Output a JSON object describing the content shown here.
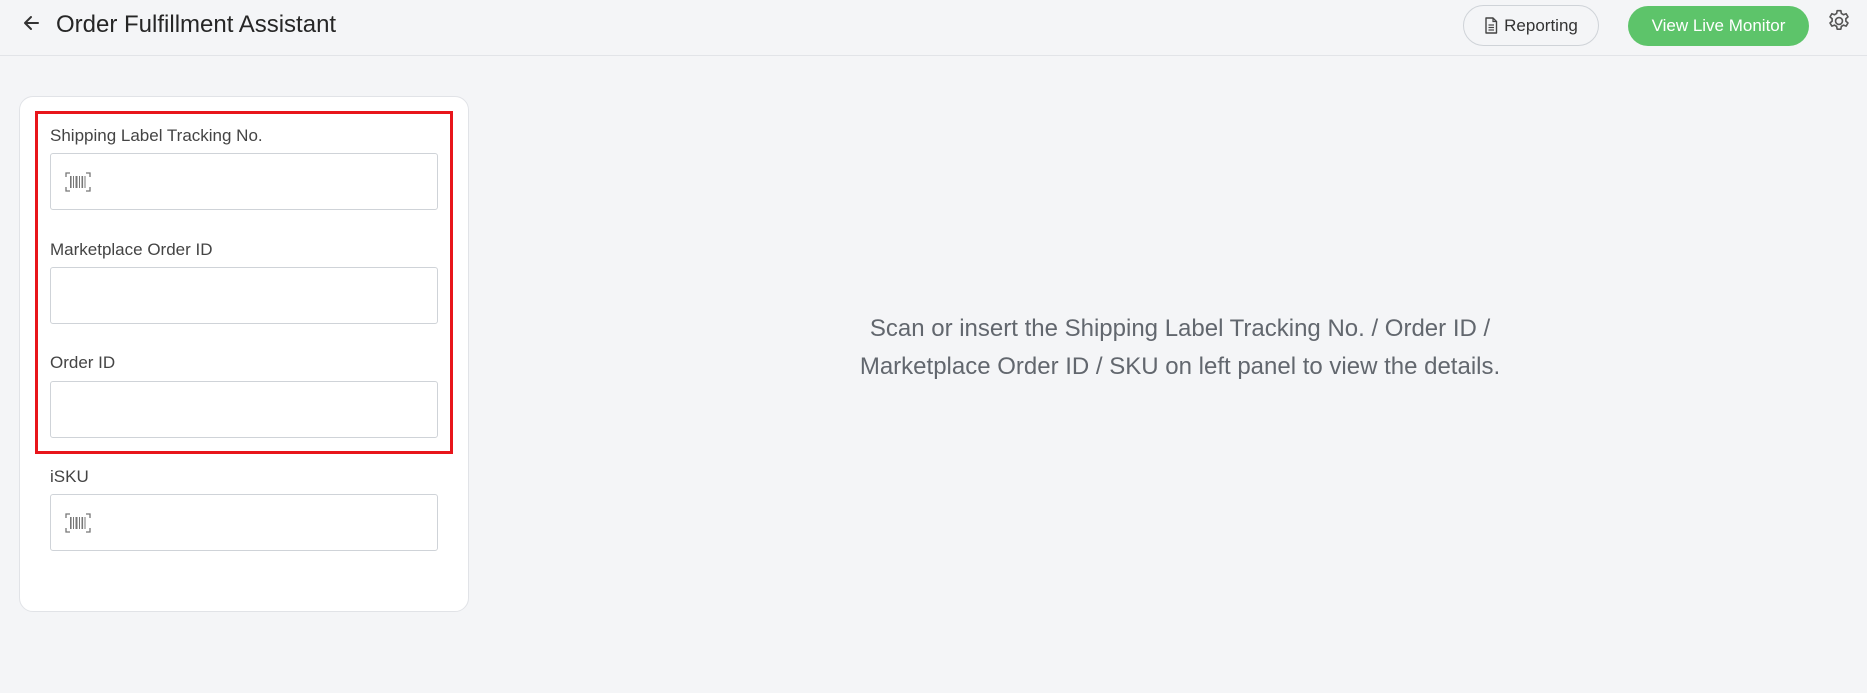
{
  "header": {
    "title": "Order Fulfillment Assistant",
    "back_icon": "arrow-left-icon",
    "reporting_label": "Reporting",
    "reporting_icon": "document-icon",
    "monitor_label": "View Live Monitor",
    "settings_icon": "gear-icon"
  },
  "panel": {
    "fields": [
      {
        "label": "Shipping Label Tracking No.",
        "value": "",
        "icon": "barcode-icon"
      },
      {
        "label": "Marketplace Order ID",
        "value": ""
      },
      {
        "label": "Order ID",
        "value": ""
      },
      {
        "label": "iSKU",
        "value": "",
        "icon": "barcode-icon"
      }
    ]
  },
  "main": {
    "empty_line1": "Scan or insert the Shipping Label Tracking No. / Order ID /",
    "empty_line2": "Marketplace Order ID / SKU on left panel to view the details."
  },
  "colors": {
    "accent_green": "#5dc46a",
    "highlight_red": "#e8151b",
    "background": "#f4f5f7"
  }
}
